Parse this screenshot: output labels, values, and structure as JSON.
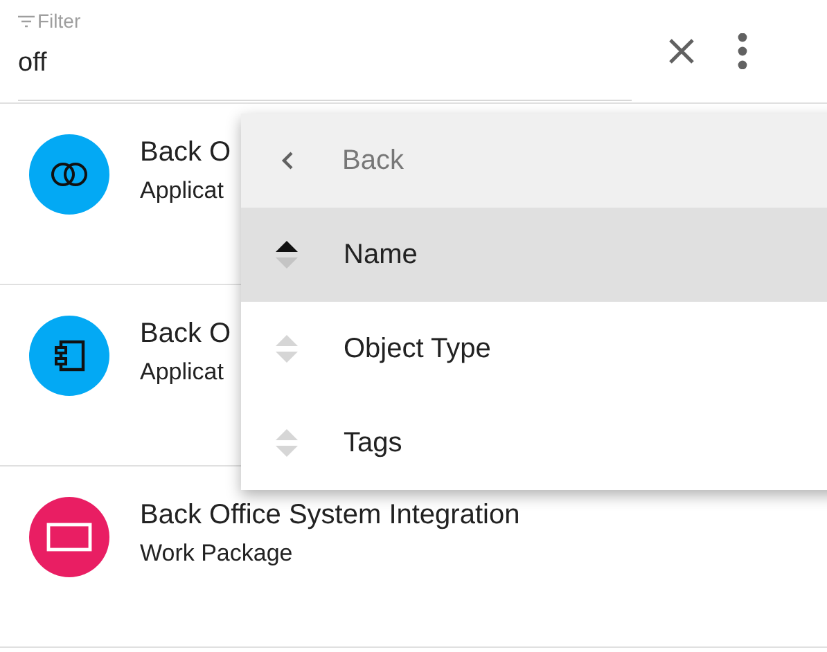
{
  "filter": {
    "label": "Filter",
    "value": "off"
  },
  "results": [
    {
      "title": "Back O",
      "subtitle": "Applicat",
      "kind": "rings",
      "color": "#03a9f4"
    },
    {
      "title": "Back O",
      "subtitle": "Applicat",
      "kind": "component",
      "color": "#03a9f4"
    },
    {
      "title": "Back Office System Integration",
      "subtitle": "Work Package",
      "kind": "rectangle",
      "color": "#e91e63"
    }
  ],
  "menu": {
    "back": "Back",
    "items": [
      {
        "label": "Name",
        "selected": true,
        "sorted": true
      },
      {
        "label": "Object Type",
        "selected": false,
        "sorted": false
      },
      {
        "label": "Tags",
        "selected": false,
        "sorted": false
      }
    ]
  }
}
